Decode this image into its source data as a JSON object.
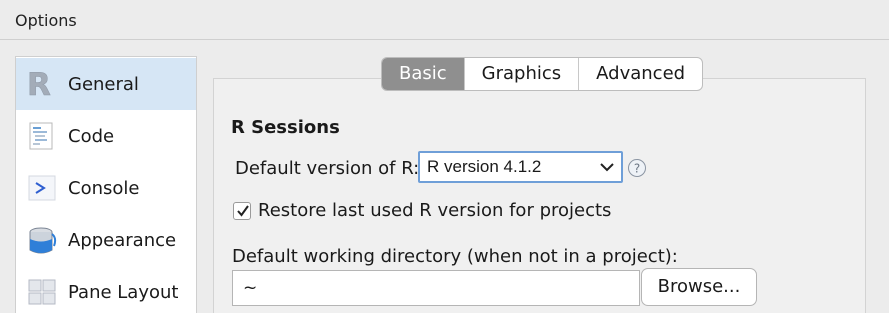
{
  "window": {
    "title": "Options"
  },
  "sidebar": {
    "items": [
      {
        "label": "General",
        "icon": "r-logo-icon",
        "selected": true
      },
      {
        "label": "Code",
        "icon": "code-document-icon",
        "selected": false
      },
      {
        "label": "Console",
        "icon": "console-prompt-icon",
        "selected": false
      },
      {
        "label": "Appearance",
        "icon": "paint-bucket-icon",
        "selected": false
      },
      {
        "label": "Pane Layout",
        "icon": "pane-grid-icon",
        "selected": false
      }
    ]
  },
  "tabs": [
    {
      "label": "Basic",
      "active": true
    },
    {
      "label": "Graphics",
      "active": false
    },
    {
      "label": "Advanced",
      "active": false
    }
  ],
  "main": {
    "section_title": "R Sessions",
    "version_label": "Default version of R:",
    "version_value": "R version 4.1.2",
    "restore_label": "Restore last used R version for projects",
    "restore_checked": true,
    "workdir_label": "Default working directory (when not in a project):",
    "workdir_value": "~",
    "browse_label": "Browse..."
  },
  "colors": {
    "selected_sidebar": "#d6e6f5",
    "active_tab": "#8f8f8f",
    "focus_ring": "#6f9fd8"
  }
}
